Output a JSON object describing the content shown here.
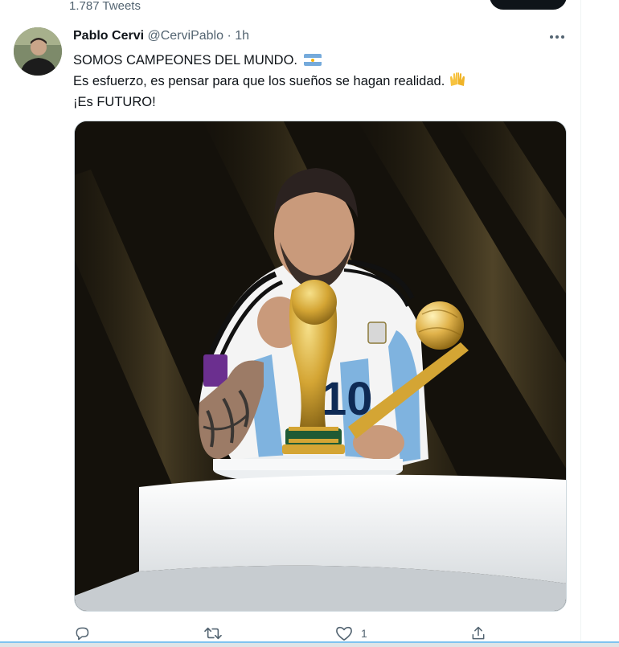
{
  "header": {
    "tweet_count": "1.787 Tweets"
  },
  "tweet": {
    "author_name": "Pablo Cervi",
    "handle": "@CerviPablo",
    "separator": "·",
    "time": "1h",
    "lines": [
      "SOMOS CAMPEONES DEL MUNDO.",
      "Es esfuerzo, es pensar para que los sueños se hagan realidad.",
      "¡Es FUTURO!"
    ],
    "emojis": [
      "argentina-flag",
      "raising-hands"
    ],
    "media": {
      "shirt_number": "10",
      "icons": [
        "world-cup-trophy",
        "golden-ball-trophy"
      ]
    },
    "actions": {
      "reply_count": "",
      "retweet_count": "",
      "like_count": "1"
    }
  },
  "colors": {
    "text_primary": "#0f1419",
    "text_secondary": "#536471",
    "border": "#cfd9de",
    "argentina_blue": "#75aadb",
    "gold": "#d4a534"
  }
}
